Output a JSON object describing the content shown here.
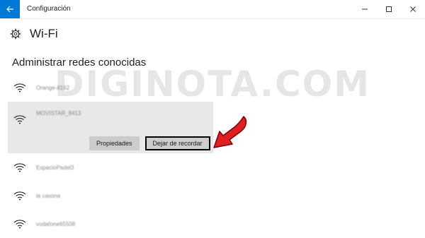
{
  "window": {
    "title": "Configuración",
    "accent_color": "#0078d7"
  },
  "icons": {
    "back": "back-arrow-icon",
    "minimize": "minimize-icon",
    "maximize": "maximize-icon",
    "close": "close-icon",
    "settings": "gear-icon",
    "network": "wifi-signal-icon",
    "pointer": "red-arrow-icon"
  },
  "header": {
    "title": "Wi-Fi"
  },
  "section": {
    "title": "Administrar redes conocidas"
  },
  "watermark": "DIGINOTA.COM",
  "networks": [
    {
      "name": "Orange-8162"
    },
    {
      "name": "MOVISTAR_8413"
    },
    {
      "name": "EspacioPadel3"
    },
    {
      "name": "la casona"
    },
    {
      "name": "vodafone65508"
    }
  ],
  "actions": {
    "properties_label": "Propiedades",
    "forget_label": "Dejar de recordar"
  },
  "annotation_color": "#e02020"
}
